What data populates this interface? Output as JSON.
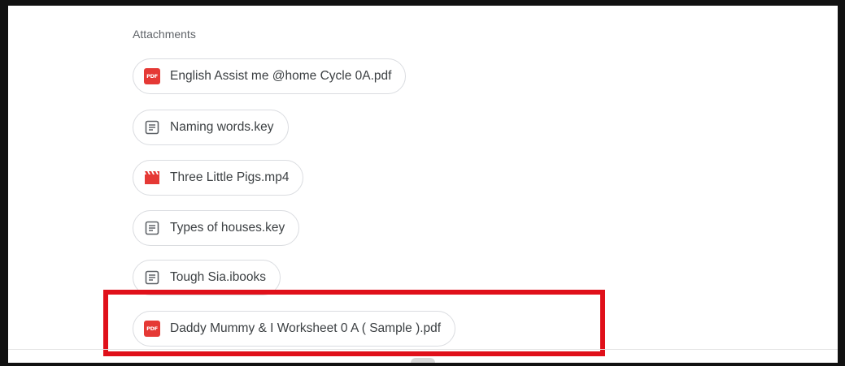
{
  "attachments": {
    "heading": "Attachments",
    "items": [
      {
        "name": "English Assist me @home Cycle 0A.pdf",
        "icon": "pdf-icon",
        "icon_text": "PDF",
        "color": "#e53935"
      },
      {
        "name": "Naming words.key",
        "icon": "document-icon",
        "color": "#5f6368"
      },
      {
        "name": "Three Little Pigs.mp4",
        "icon": "video-icon",
        "color": "#e53935"
      },
      {
        "name": "Types of houses.key",
        "icon": "document-icon",
        "color": "#5f6368"
      },
      {
        "name": "Tough Sia.ibooks",
        "icon": "document-icon",
        "color": "#5f6368"
      },
      {
        "name": "Daddy Mummy & I Worksheet 0 A ( Sample ).pdf",
        "icon": "pdf-icon",
        "icon_text": "PDF",
        "color": "#e53935",
        "highlighted": true
      }
    ]
  },
  "colors": {
    "highlight": "#e0101a",
    "chip_border": "#dadce0",
    "text": "#3c4043"
  }
}
